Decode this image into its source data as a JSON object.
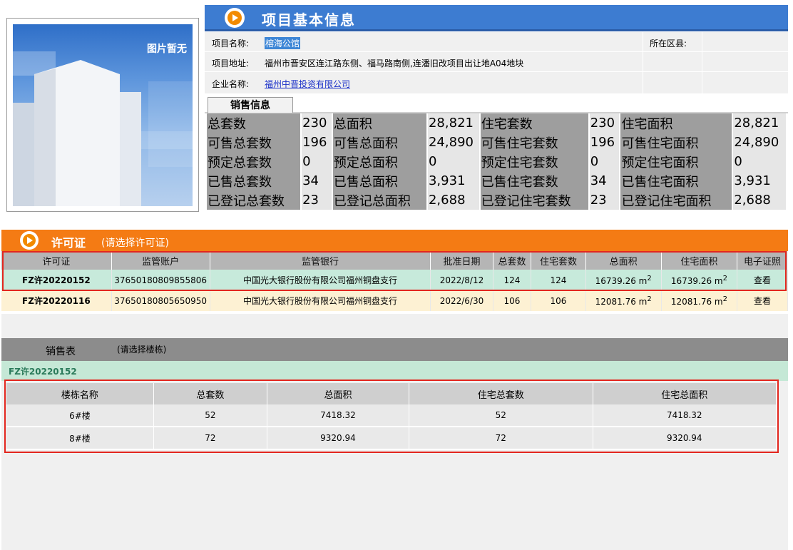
{
  "photo": {
    "placeholder_text": "图片暂无"
  },
  "header": {
    "title": "项目基本信息"
  },
  "project": {
    "name_label": "项目名称:",
    "name": "榕海公馆",
    "address_label": "项目地址:",
    "address": "福州市晋安区连江路东侧、福马路南侧,连潘旧改项目出让地A04地块",
    "company_label": "企业名称:",
    "company": "福州中晋投资有限公司",
    "district_label": "所在区县:",
    "district": ""
  },
  "sales_info": {
    "tab_label": "销售信息",
    "rows": [
      [
        {
          "l": "总套数",
          "v": "230"
        },
        {
          "l": "总面积",
          "v": "28,821"
        },
        {
          "l": "住宅套数",
          "v": "230"
        },
        {
          "l": "住宅面积",
          "v": "28,821"
        }
      ],
      [
        {
          "l": "可售总套数",
          "v": "196"
        },
        {
          "l": "可售总面积",
          "v": "24,890"
        },
        {
          "l": "可售住宅套数",
          "v": "196"
        },
        {
          "l": "可售住宅面积",
          "v": "24,890"
        }
      ],
      [
        {
          "l": "预定总套数",
          "v": "0"
        },
        {
          "l": "预定总面积",
          "v": "0"
        },
        {
          "l": "预定住宅套数",
          "v": "0"
        },
        {
          "l": "预定住宅面积",
          "v": "0"
        }
      ],
      [
        {
          "l": "已售总套数",
          "v": "34"
        },
        {
          "l": "已售总面积",
          "v": "3,931"
        },
        {
          "l": "已售住宅套数",
          "v": "34"
        },
        {
          "l": "已售住宅面积",
          "v": "3,931"
        }
      ],
      [
        {
          "l": "已登记总套数",
          "v": "23"
        },
        {
          "l": "已登记总面积",
          "v": "2,688"
        },
        {
          "l": "已登记住宅套数",
          "v": "23"
        },
        {
          "l": "已登记住宅面积",
          "v": "2,688"
        }
      ]
    ]
  },
  "permit": {
    "title": "许可证",
    "subtitle": "(请选择许可证)",
    "columns": [
      "许可证",
      "监管账户",
      "监管银行",
      "批准日期",
      "总套数",
      "住宅套数",
      "总面积",
      "住宅面积",
      "电子证照"
    ],
    "rows": [
      {
        "id": "FZ许20220152",
        "account": "37650180809855806",
        "bank": "中国光大银行股份有限公司福州铜盘支行",
        "date": "2022/8/12",
        "total": "124",
        "res": "124",
        "area": "16739.26 m",
        "res_area": "16739.26 m",
        "view": "查看"
      },
      {
        "id": "FZ许20220116",
        "account": "37650180805650950",
        "bank": "中国光大银行股份有限公司福州铜盘支行",
        "date": "2022/6/30",
        "total": "106",
        "res": "106",
        "area": "12081.76 m",
        "res_area": "12081.76 m",
        "view": "查看"
      }
    ]
  },
  "sales_table": {
    "label": "销售表",
    "note": "(请选择楼栋)",
    "selected_permit": "FZ许20220152",
    "columns": [
      "楼栋名称",
      "总套数",
      "总面积",
      "住宅总套数",
      "住宅总面积"
    ],
    "rows": [
      [
        "6#楼",
        "52",
        "7418.32",
        "52",
        "7418.32"
      ],
      [
        "8#楼",
        "72",
        "9320.94",
        "72",
        "9320.94"
      ]
    ]
  },
  "colors": {
    "header_blue": "#3d7cd1",
    "permit_orange": "#f47b14",
    "highlight_red": "#e3261e",
    "selected_green": "#c7eadb"
  }
}
